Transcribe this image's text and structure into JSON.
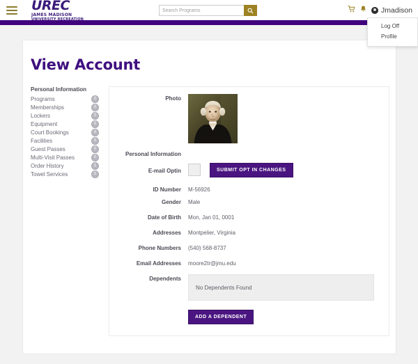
{
  "header": {
    "menu_icon": "hamburger-icon",
    "logo": {
      "main": "UREC",
      "sub1": "JAMES MADISON",
      "sub2": "UNIVERSITY RECREATION"
    },
    "search": {
      "placeholder": "Search Programs",
      "value": "",
      "button_icon": "search-icon"
    },
    "cart_icon": "cart-icon",
    "bell_icon": "bell-icon",
    "user_name": "Jmadison",
    "avatar_icon": "avatar-icon",
    "accent_purple": "#41027e",
    "accent_gold": "#9c8222"
  },
  "user_menu": {
    "items": [
      {
        "label": "Log Off"
      },
      {
        "label": "Profile"
      }
    ]
  },
  "page": {
    "title": "View Account"
  },
  "sidebar": {
    "heading": "Personal Information",
    "items": [
      {
        "label": "Programs",
        "badge": "0"
      },
      {
        "label": "Memberships",
        "badge": "0"
      },
      {
        "label": "Lockers",
        "badge": "0"
      },
      {
        "label": "Equipment",
        "badge": "0"
      },
      {
        "label": "Court Bookings",
        "badge": "0"
      },
      {
        "label": "Facilities",
        "badge": "0"
      },
      {
        "label": "Guest Passes",
        "badge": "0"
      },
      {
        "label": "Multi-Visit Passes",
        "badge": "0"
      },
      {
        "label": "Order History",
        "badge": "1"
      },
      {
        "label": "Towel Services",
        "badge": "0"
      }
    ]
  },
  "account": {
    "photo_label": "Photo",
    "photo_alt": "portrait-photo",
    "personal_information_label": "Personal Information",
    "email_optin_label": "E-mail Optin",
    "email_optin_checked": false,
    "submit_optin_label": "SUBMIT OPT IN CHANGES",
    "fields": [
      {
        "label": "ID Number",
        "value": "M-56926"
      },
      {
        "label": "Gender",
        "value": "Male"
      },
      {
        "label": "Date of Birth",
        "value": "Mon, Jan 01, 0001"
      },
      {
        "label": "Addresses",
        "value": "Montpelier, Virginia"
      },
      {
        "label": "Phone Numbers",
        "value": "(540) 568-8737"
      },
      {
        "label": "Email Addresses",
        "value": "moore2tr@jmu.edu"
      }
    ],
    "dependents_label": "Dependents",
    "dependents_empty_text": "No Dependents Found",
    "add_dependent_label": "ADD A DEPENDENT"
  }
}
